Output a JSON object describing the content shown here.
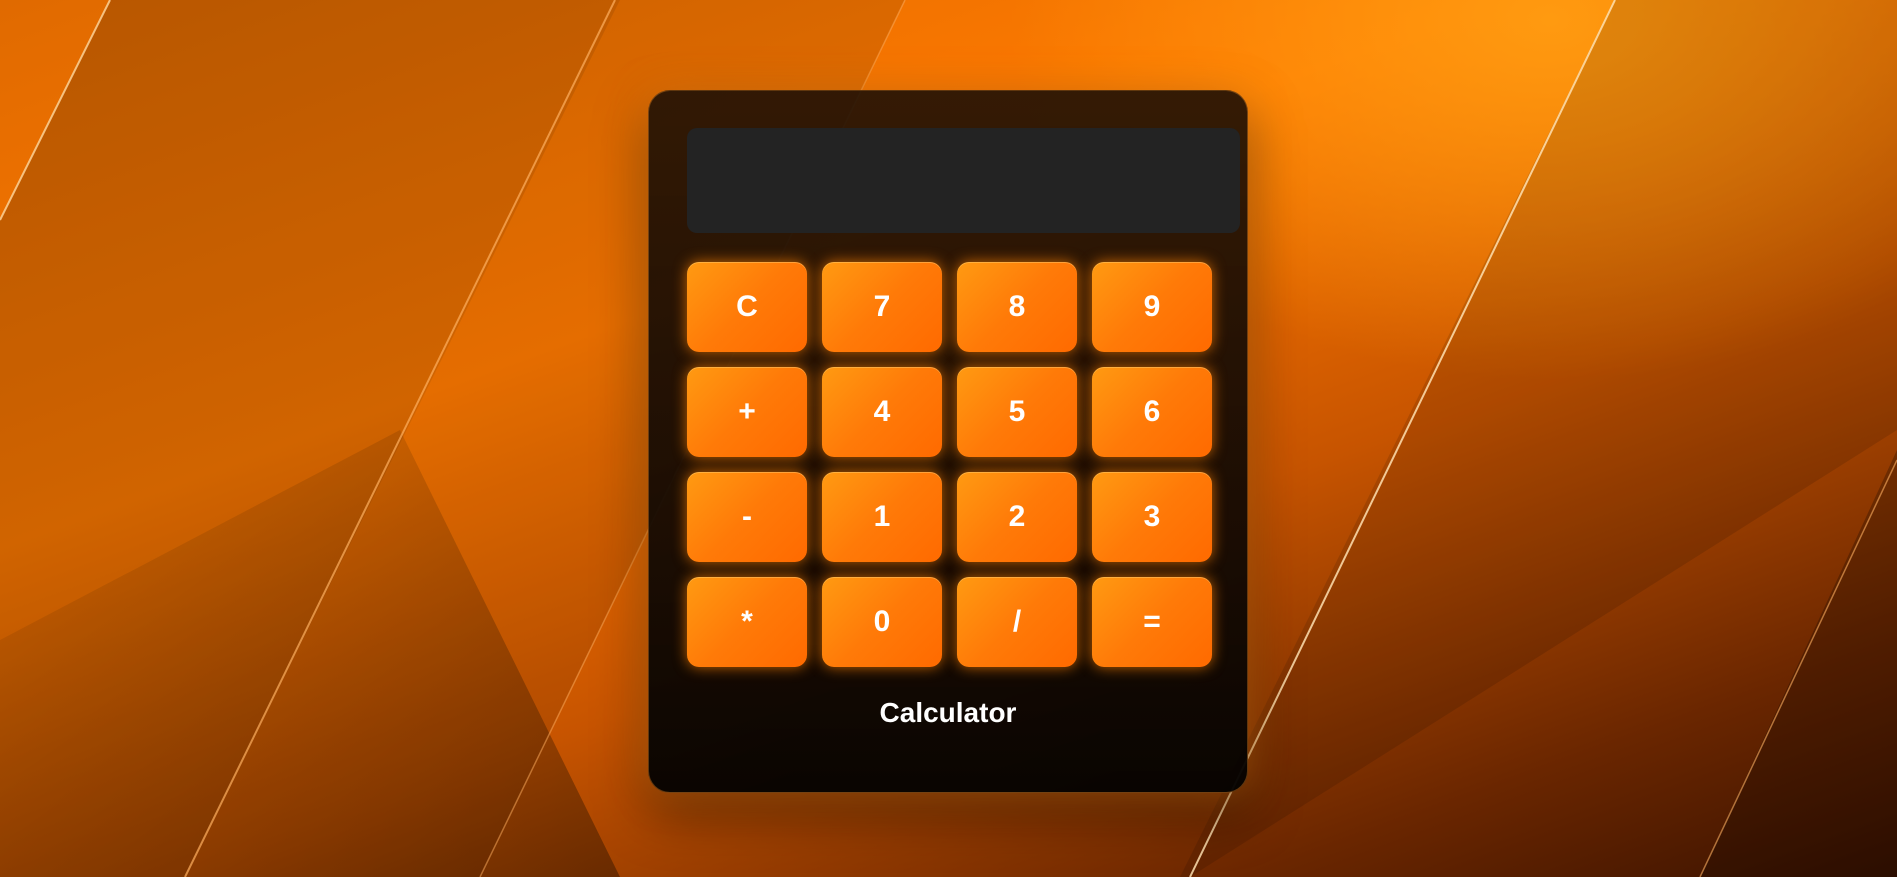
{
  "calculator": {
    "title": "Calculator",
    "display_value": "",
    "keys": [
      "C",
      "7",
      "8",
      "9",
      "+",
      "4",
      "5",
      "6",
      "-",
      "1",
      "2",
      "3",
      "*",
      "0",
      "/",
      "="
    ]
  },
  "colors": {
    "accent": "#ff7a00",
    "panel": "#140a03",
    "display": "#232323"
  }
}
